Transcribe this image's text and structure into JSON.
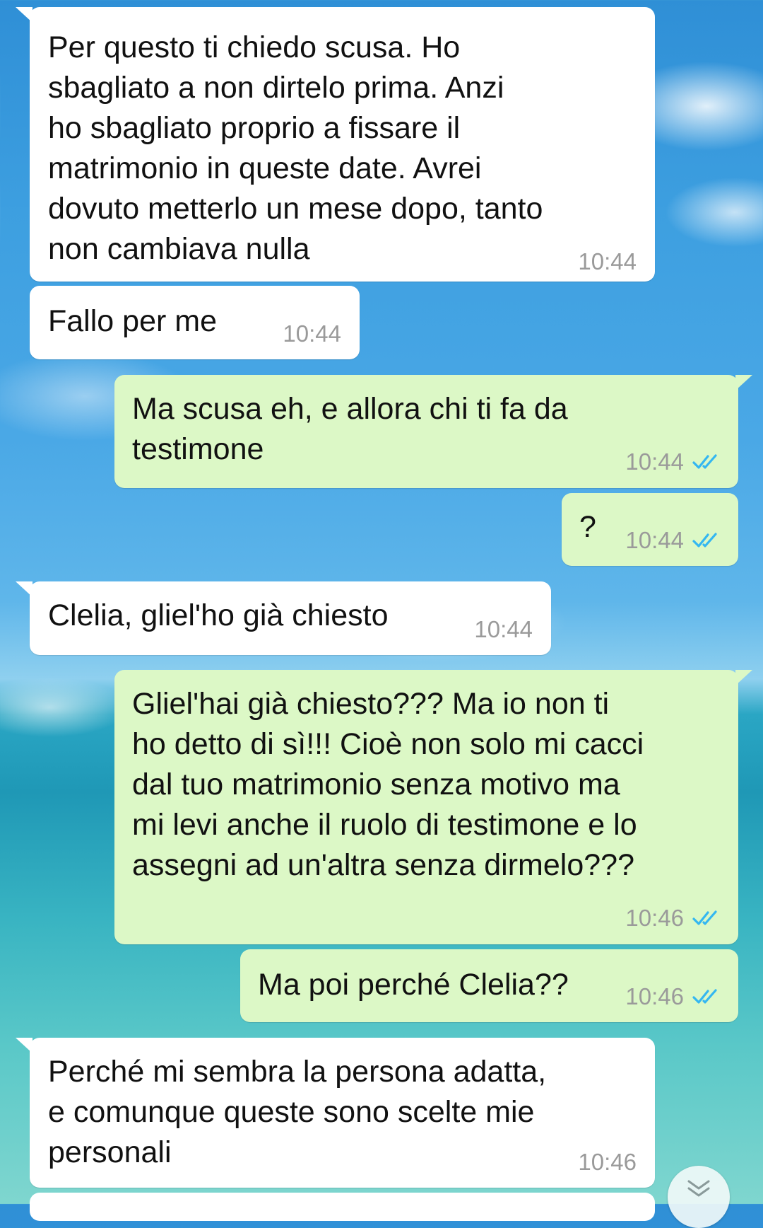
{
  "colors": {
    "incoming_bubble": "#ffffff",
    "outgoing_bubble": "#dcf8c6",
    "timestamp": "#9a9a9a",
    "read_ticks": "#34b7f1"
  },
  "messages": [
    {
      "direction": "incoming",
      "text": "Per questo ti chiedo scusa. Ho\nsbagliato a non dirtelo prima. Anzi\nho sbagliato proprio a fissare il\nmatrimonio in queste date. Avrei\ndovuto metterlo un mese dopo, tanto\nnon cambiava nulla",
      "time": "10:44"
    },
    {
      "direction": "incoming",
      "text": "Fallo per me",
      "time": "10:44"
    },
    {
      "direction": "outgoing",
      "text": "Ma scusa eh, e allora chi ti fa da\ntestimone",
      "time": "10:44",
      "status_icon": "double-check-icon"
    },
    {
      "direction": "outgoing",
      "text": "?",
      "time": "10:44",
      "status_icon": "double-check-icon"
    },
    {
      "direction": "incoming",
      "text": "Clelia, gliel'ho già chiesto",
      "time": "10:44"
    },
    {
      "direction": "outgoing",
      "text": "Gliel'hai già chiesto??? Ma io non ti\nho detto di sì!!! Cioè non solo mi cacci\ndal tuo matrimonio senza motivo ma\nmi levi anche il ruolo di testimone e lo\nassegni ad un'altra senza dirmelo???",
      "time": "10:46",
      "status_icon": "double-check-icon"
    },
    {
      "direction": "outgoing",
      "text": "Ma poi perché Clelia??",
      "time": "10:46",
      "status_icon": "double-check-icon"
    },
    {
      "direction": "incoming",
      "text": "Perché mi sembra la persona adatta,\ne comunque queste sono scelte mie\npersonali",
      "time": "10:46"
    }
  ],
  "scroll_button": {
    "icon": "double-chevron-down-icon"
  }
}
